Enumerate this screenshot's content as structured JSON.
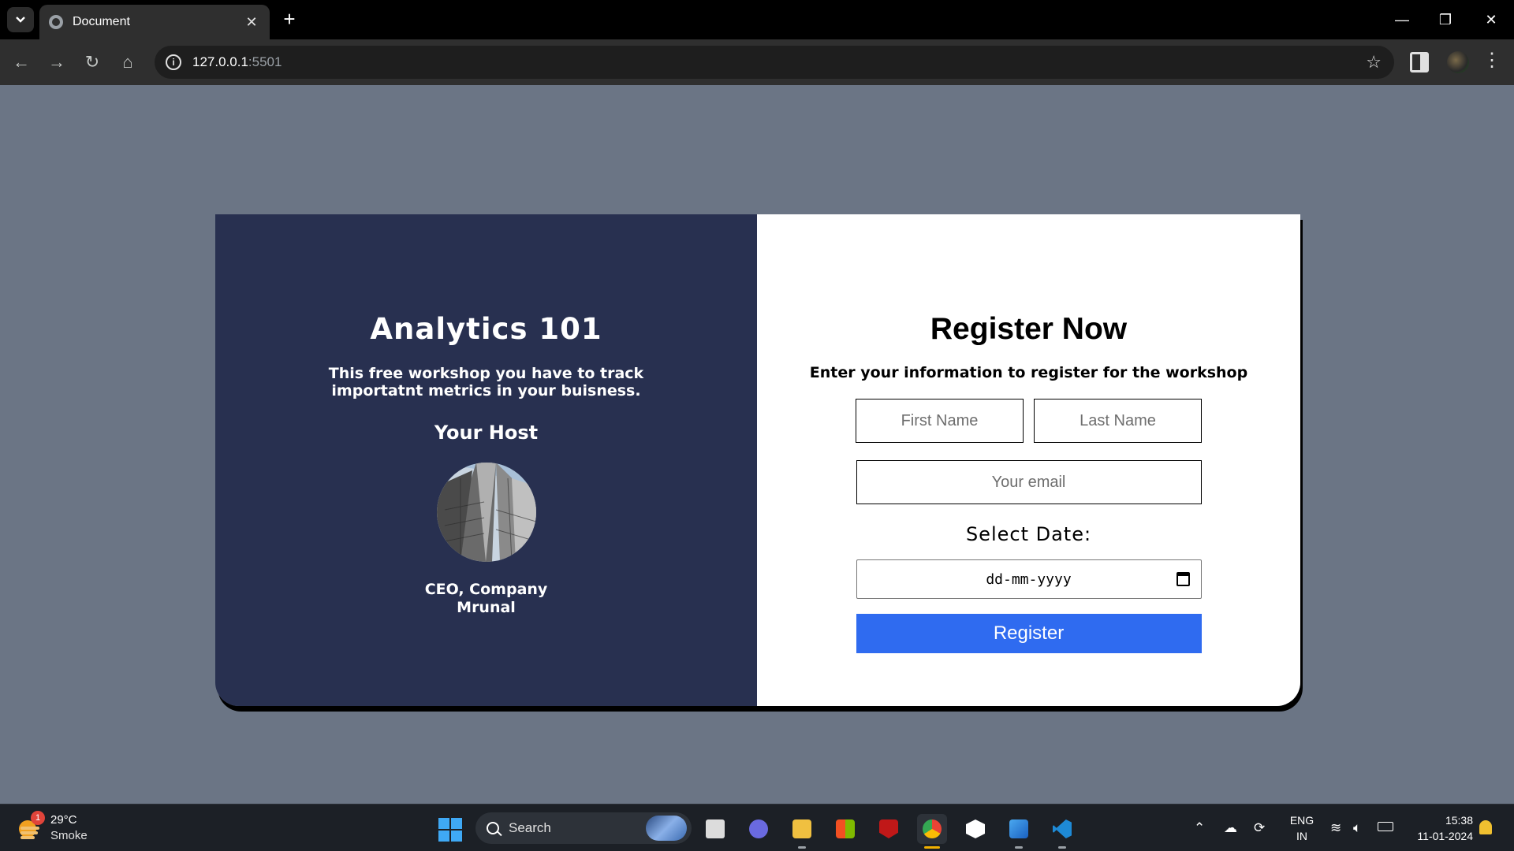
{
  "browser": {
    "tab_title": "Document",
    "url_host": "127.0.0.1",
    "url_port": ":5501"
  },
  "left_panel": {
    "title": "Analytics 101",
    "description_line1": "This free workshop you have to track",
    "description_line2": "importatnt metrics in your buisness.",
    "host_heading": "Your Host",
    "host_role": "CEO, Company",
    "host_name": "Mrunal"
  },
  "right_panel": {
    "title": "Register Now",
    "subtitle": "Enter your information to register for the workshop",
    "first_name_placeholder": "First Name",
    "last_name_placeholder": "Last Name",
    "email_placeholder": "Your email",
    "date_label": "Select Date:",
    "date_placeholder": "dd-mm-yyyy",
    "register_label": "Register"
  },
  "taskbar": {
    "weather_temp": "29°C",
    "weather_desc": "Smoke",
    "weather_badge": "1",
    "search_label": "Search",
    "lang_line1": "ENG",
    "lang_line2": "IN",
    "time": "15:38",
    "date": "11-01-2024"
  },
  "colors": {
    "page_bg": "#6b7585",
    "left_panel_bg": "#283050",
    "register_button": "#2f6bf0"
  }
}
